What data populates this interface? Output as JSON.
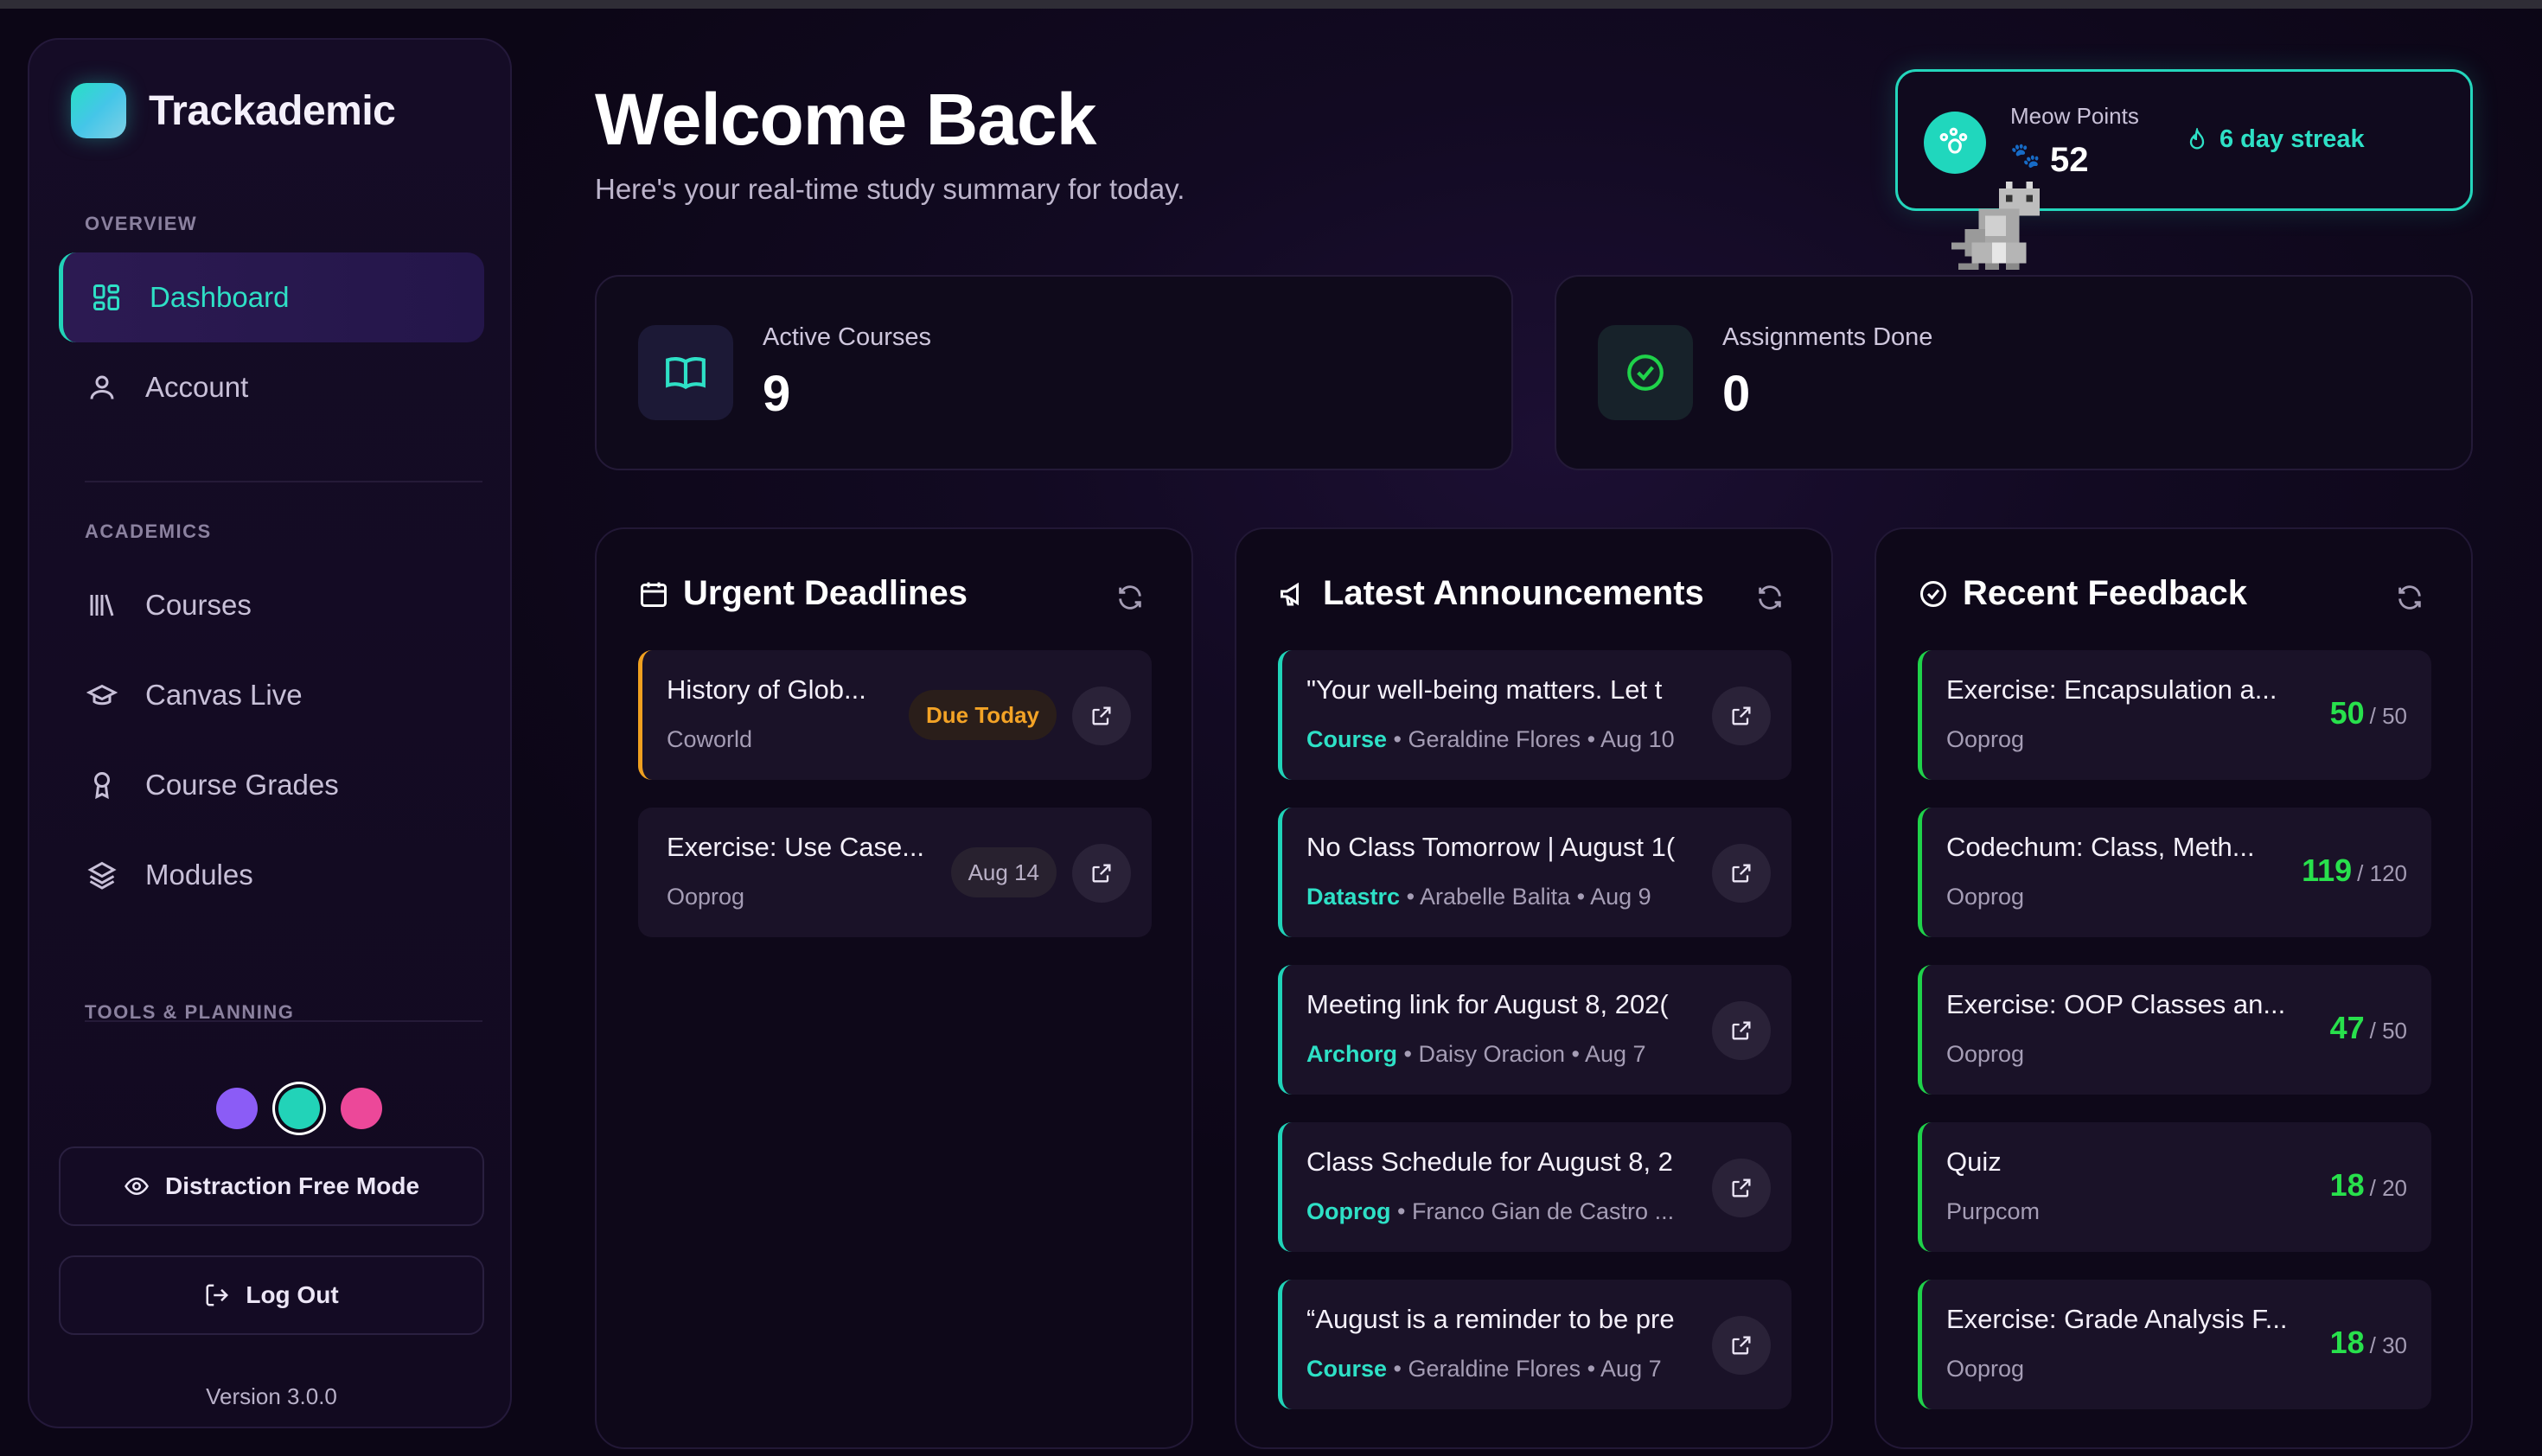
{
  "app": {
    "name": "Trackademic",
    "version": "Version 3.0.0"
  },
  "colors": {
    "accent": "#22d3b8",
    "background": "#0d0717",
    "urgent": "#f0a020",
    "success": "#1fd24a",
    "swatches": [
      "#8b5cf6",
      "#22d3b8",
      "#ec4899"
    ]
  },
  "sidebar": {
    "overview_label": "OVERVIEW",
    "overview_items": [
      {
        "label": "Dashboard",
        "icon": "grid-icon",
        "active": true
      },
      {
        "label": "Account",
        "icon": "user-icon"
      }
    ],
    "academics_label": "ACADEMICS",
    "academic_items": [
      {
        "label": "Courses",
        "icon": "library-icon"
      },
      {
        "label": "Canvas Live",
        "icon": "graduation-cap-icon"
      },
      {
        "label": "Course Grades",
        "icon": "award-icon"
      },
      {
        "label": "Modules",
        "icon": "layers-icon"
      }
    ],
    "tools_label": "TOOLS & PLANNING",
    "distraction_button": "Distraction Free Mode",
    "logout_button": "Log Out"
  },
  "header": {
    "title": "Welcome Back",
    "subtitle": "Here's your real-time study summary for today."
  },
  "meow": {
    "label": "Meow Points",
    "value": "52",
    "streak": "6 day streak"
  },
  "stats": {
    "courses_label": "Active Courses",
    "courses_value": "9",
    "assignments_label": "Assignments Done",
    "assignments_value": "0"
  },
  "deadlines": {
    "title": "Urgent Deadlines",
    "items": [
      {
        "title": "History of Glob...",
        "course": "Coworld",
        "badge": "Due Today"
      },
      {
        "title": "Exercise: Use Case...",
        "course": "Ooprog",
        "badge": "Aug 14"
      }
    ]
  },
  "announcements": {
    "title": "Latest Announcements",
    "items": [
      {
        "title": "\"Your well-being matters. Let t",
        "course": "Course",
        "meta": " • Geraldine Flores • Aug 10"
      },
      {
        "title": "No Class Tomorrow | August 1(",
        "course": "Datastrc",
        "meta": " • Arabelle Balita • Aug 9"
      },
      {
        "title": "Meeting link for August 8, 202(",
        "course": "Archorg",
        "meta": " • Daisy Oracion • Aug 7"
      },
      {
        "title": "Class Schedule for August 8, 2",
        "course": "Ooprog",
        "meta": " • Franco Gian de Castro ..."
      },
      {
        "title": "“August is a reminder to be pre",
        "course": "Course",
        "meta": " • Geraldine Flores • Aug 7"
      }
    ]
  },
  "feedback": {
    "title": "Recent Feedback",
    "items": [
      {
        "title": "Exercise: Encapsulation a...",
        "course": "Ooprog",
        "score": "50",
        "total": "/ 50"
      },
      {
        "title": "Codechum: Class, Meth...",
        "course": "Ooprog",
        "score": "119",
        "total": "/ 120"
      },
      {
        "title": "Exercise: OOP Classes an...",
        "course": "Ooprog",
        "score": "47",
        "total": "/ 50"
      },
      {
        "title": "Quiz",
        "course": "Purpcom",
        "score": "18",
        "total": "/ 20"
      },
      {
        "title": "Exercise: Grade Analysis F...",
        "course": "Ooprog",
        "score": "18",
        "total": "/ 30"
      }
    ]
  }
}
